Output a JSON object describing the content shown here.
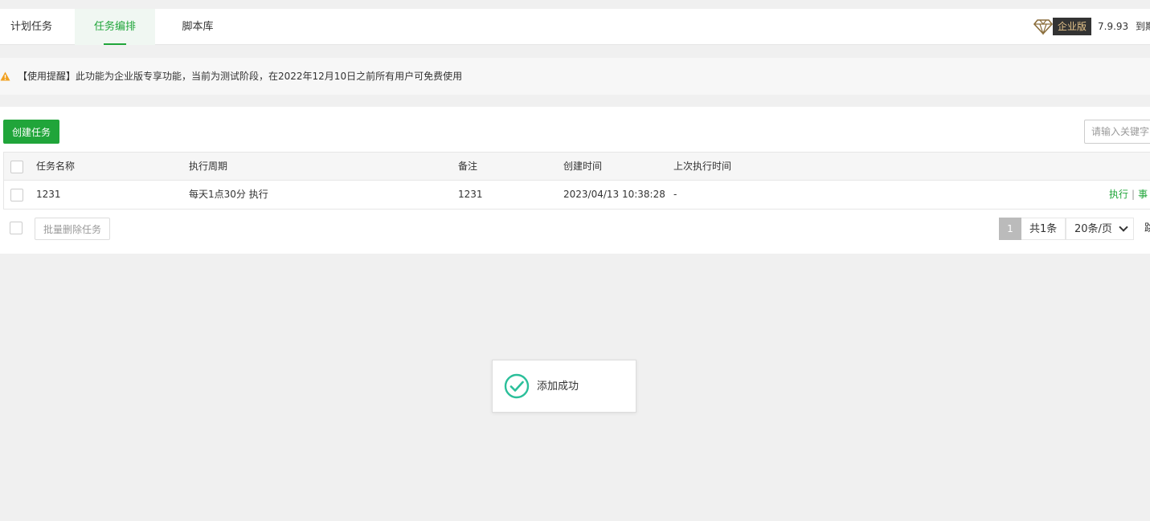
{
  "tabs": [
    {
      "label": "计划任务"
    },
    {
      "label": "任务编排"
    },
    {
      "label": "脚本库"
    }
  ],
  "header": {
    "edition": "企业版",
    "version": "7.9.93",
    "expire": "到期"
  },
  "notice": {
    "text": "【使用提醒】此功能为企业版专享功能，当前为测试阶段，在2022年12月10日之前所有用户可免费使用"
  },
  "toolbar": {
    "create_label": "创建任务",
    "search_placeholder": "请输入关键字"
  },
  "table": {
    "headers": [
      "任务名称",
      "执行周期",
      "备注",
      "创建时间",
      "上次执行时间"
    ],
    "rows": [
      {
        "name": "1231",
        "cycle": "每天1点30分 执行",
        "note": "1231",
        "created": "2023/04/13 10:38:28",
        "last_run": "-",
        "op_run": "执行",
        "op_more": "事"
      }
    ]
  },
  "footer": {
    "batch_delete_label": "批量删除任务",
    "current_page": "1",
    "total": "共1条",
    "page_size": "20条/页",
    "jump": "跳"
  },
  "toast": {
    "text": "添加成功"
  },
  "colors": {
    "accent": "#20a53a",
    "badge_bg": "#333333",
    "badge_text": "#e7c58b",
    "warning": "#f0a020"
  }
}
